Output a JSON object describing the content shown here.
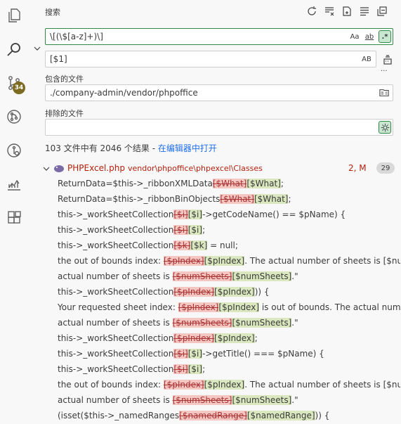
{
  "activity_bar": {
    "scm_badge": "34"
  },
  "search": {
    "title": "搜索",
    "query": "\\[(\\$[a-z]+)\\]",
    "match_case_label": "Aa",
    "whole_word_label": "ab",
    "regex_label": ".*",
    "replace": "[$1]",
    "preserve_case_label": "AB",
    "include_label": "包含的文件",
    "include_value": "./company-admin/vendor/phpoffice",
    "exclude_label": "排除的文件",
    "exclude_value": "",
    "more_label": "···",
    "summary_text": "103 文件中有 2046 个结果 - ",
    "summary_link": "在编辑器中打开"
  },
  "results": {
    "file": {
      "name": "PHPExcel.php",
      "path": "vendor\\phpoffice\\phpexcel\\Classes",
      "status": "2, M",
      "count": "29"
    },
    "matches": [
      {
        "pre": "ReturnData=$this->_ribbonXMLData",
        "del": "[$What]",
        "ins": "[$What]",
        "post": ";"
      },
      {
        "pre": "ReturnData=$this->_ribbonBinObjects",
        "del": "[$What]",
        "ins": "[$What]",
        "post": ";"
      },
      {
        "pre": "this->_workSheetCollection",
        "del": "[$i]",
        "ins": "[$i]",
        "post": "->getCodeName() == $pName) {"
      },
      {
        "pre": "this->_workSheetCollection",
        "del": "[$i]",
        "ins": "[$i]",
        "post": ";"
      },
      {
        "pre": "this->_workSheetCollection",
        "del": "[$k]",
        "ins": "[$k]",
        "post": " = null;"
      },
      {
        "pre": "the out of bounds index: ",
        "del": "[$pIndex]",
        "ins": "[$pIndex]",
        "post": ". The actual number of sheets is [$num..."
      },
      {
        "pre": "actual number of sheets is ",
        "del": "[$numSheets]",
        "ins": "[$numSheets]",
        "post": ".\""
      },
      {
        "pre": "this->_workSheetCollection",
        "del": "[$pIndex]",
        "ins": "[$pIndex]",
        "post": ")) {"
      },
      {
        "pre": "Your requested sheet index: ",
        "del": "[$pIndex]",
        "ins": "[$pIndex]",
        "post": " is out of bounds. The actual numbe..."
      },
      {
        "pre": "actual number of sheets is ",
        "del": "[$numSheets]",
        "ins": "[$numSheets]",
        "post": ".\""
      },
      {
        "pre": "this->_workSheetCollection",
        "del": "[$pIndex]",
        "ins": "[$pIndex]",
        "post": ";"
      },
      {
        "pre": "this->_workSheetCollection",
        "del": "[$i]",
        "ins": "[$i]",
        "post": "->getTitle() === $pName) {"
      },
      {
        "pre": "this->_workSheetCollection",
        "del": "[$i]",
        "ins": "[$i]",
        "post": ";"
      },
      {
        "pre": "the out of bounds index: ",
        "del": "[$pIndex]",
        "ins": "[$pIndex]",
        "post": ". The actual number of sheets is [$num..."
      },
      {
        "pre": "actual number of sheets is ",
        "del": "[$numSheets]",
        "ins": "[$numSheets]",
        "post": ".\""
      },
      {
        "pre": "(isset($this->_namedRanges",
        "del": "[$namedRange]",
        "ins": "[$namedRange]",
        "post": ")) {"
      }
    ]
  }
}
